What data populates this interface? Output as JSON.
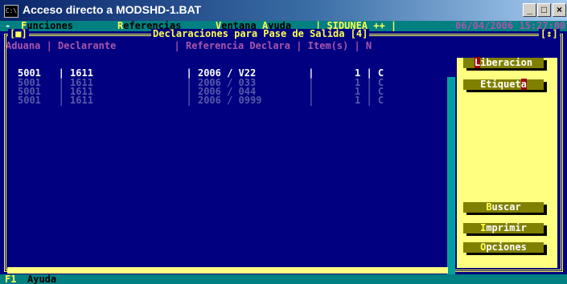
{
  "window": {
    "title": "Acceso directo a MODSHD-1.BAT",
    "system_icon_text": "C:\\",
    "minimize_glyph": "_",
    "maximize_glyph": "□",
    "close_glyph": "×"
  },
  "menubar": {
    "system_label": "-",
    "items": [
      {
        "hot": "F",
        "rest": "unciones"
      },
      {
        "hot": "R",
        "rest": "eferencias"
      },
      {
        "hot": "V",
        "rest": "entana"
      },
      {
        "hot": "A",
        "rest": "yuda"
      }
    ],
    "app_label": "| SIDUNEA ++ |",
    "datetime": "06/04/2006 15:27:00"
  },
  "window_frame": {
    "close_marker": "[■]",
    "title": "Declaraciones para Pase de Salida [4]",
    "zoom_marker": "[↕]"
  },
  "table": {
    "header": "Aduana | Declarante          | Referencia Declara | Item(s) | N",
    "rows": [
      {
        "text": "5001   | 1611                | 2006 / V22         |       1 | C",
        "selected": true
      },
      {
        "text": "5001   | 1611                | 2006 / 033         |       1 | C",
        "selected": false
      },
      {
        "text": "5001   | 1611                | 2006 / 044         |       1 | C",
        "selected": false
      },
      {
        "text": "5001   | 1611                | 2006 / 0999        |       1 | C",
        "selected": false
      }
    ]
  },
  "side_buttons": {
    "liberacion": {
      "hot": "L",
      "rest": "iberacion"
    },
    "etiqueta": {
      "pre": "Etiquet",
      "hot": "a"
    },
    "buscar": {
      "hot": "B",
      "rest": "uscar"
    },
    "imprimir": {
      "hot": "I",
      "rest": "mprimir"
    },
    "opciones": {
      "hot": "O",
      "rest": "pciones"
    }
  },
  "statusbar": {
    "key": "F1",
    "label": "Ayuda"
  },
  "colors": {
    "console_bg": "#000080",
    "menu_bg": "#008080",
    "frame": "#ffff55",
    "header_text": "#aa55aa",
    "button_bg": "#808000",
    "side_panel": "#ffff80"
  }
}
